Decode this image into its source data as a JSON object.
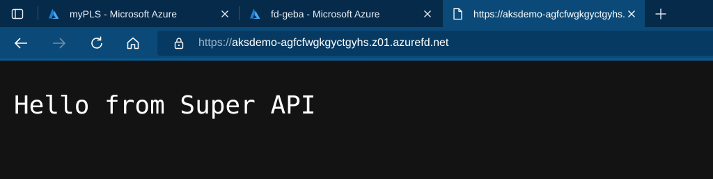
{
  "tabs": [
    {
      "title": "myPLS - Microsoft Azure",
      "icon": "azure-logo-icon",
      "active": false
    },
    {
      "title": "fd-geba - Microsoft Azure",
      "icon": "azure-logo-icon",
      "active": false
    },
    {
      "title": "https://aksdemo-agfcfwgkgyctgyhs.z01.azurefd.net",
      "icon": "page-icon",
      "active": true
    }
  ],
  "toolbar": {
    "address": {
      "scheme": "https://",
      "host": "aksdemo-agfcfwgkgyctgyhs.z01.azurefd.net"
    }
  },
  "page": {
    "body_text": "Hello from Super API"
  },
  "colors": {
    "tabstrip_bg": "#062a4a",
    "toolbar_bg": "#0b4a78",
    "addressbar_bg": "#063a62",
    "page_bg": "#131313",
    "azure_blue": "#2b8fe0"
  }
}
